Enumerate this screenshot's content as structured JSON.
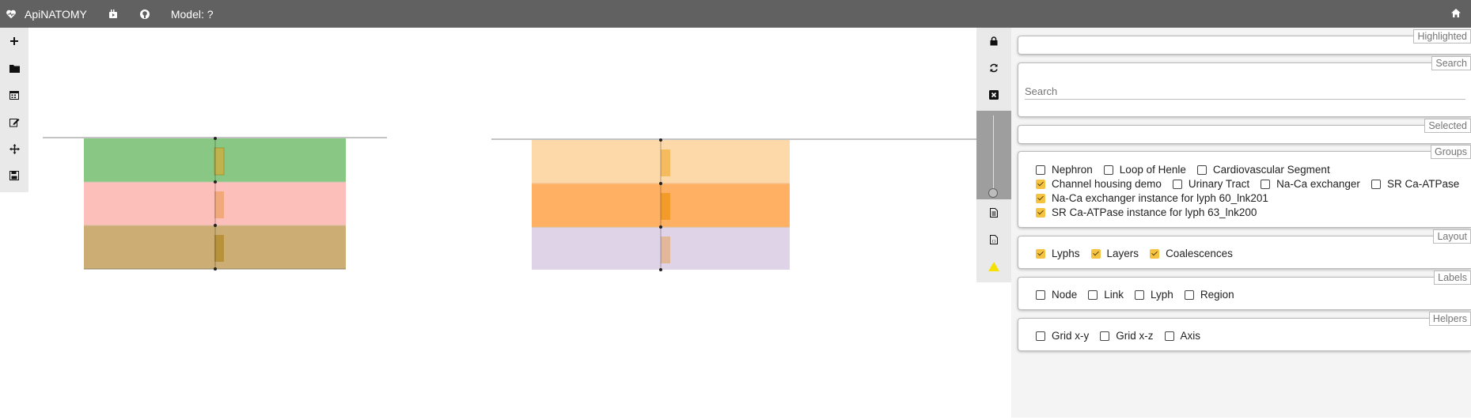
{
  "topbar": {
    "app_name": "ApiNATOMY",
    "model_label": "Model: ?",
    "icons": [
      "heart-icon",
      "youtube-icon",
      "github-icon",
      "home-icon"
    ]
  },
  "left_toolbar": [
    "plus-icon",
    "folder-icon",
    "calendar-icon",
    "edit-icon",
    "move-icon",
    "save-icon"
  ],
  "right_toolbar": {
    "icons": [
      "lock-icon",
      "refresh-icon",
      "close-icon",
      "file-icon",
      "json-file-icon",
      "warning-icon"
    ],
    "zoom_level": 0
  },
  "panel": {
    "highlighted": {
      "legend": "Highlighted",
      "value": ""
    },
    "search": {
      "legend": "Search",
      "placeholder": "Search"
    },
    "selected": {
      "legend": "Selected",
      "value": ""
    },
    "groups": {
      "legend": "Groups",
      "rows": [
        [
          {
            "label": "Nephron",
            "checked": false
          },
          {
            "label": "Loop of Henle",
            "checked": false
          },
          {
            "label": "Cardiovascular Segment",
            "checked": false
          }
        ],
        [
          {
            "label": "Channel housing demo",
            "checked": true
          },
          {
            "label": "Urinary Tract",
            "checked": false
          },
          {
            "label": "Na-Ca exchanger",
            "checked": false
          },
          {
            "label": "SR Ca-ATPase",
            "checked": false
          }
        ],
        [
          {
            "label": "Na-Ca exchanger instance for lyph 60_lnk201",
            "checked": true
          }
        ],
        [
          {
            "label": "SR Ca-ATPase instance for lyph 63_lnk200",
            "checked": true
          }
        ]
      ]
    },
    "layout": {
      "legend": "Layout",
      "items": [
        {
          "label": "Lyphs",
          "checked": true
        },
        {
          "label": "Layers",
          "checked": true
        },
        {
          "label": "Coalescences",
          "checked": true
        }
      ]
    },
    "labels": {
      "legend": "Labels",
      "items": [
        {
          "label": "Node",
          "checked": false
        },
        {
          "label": "Link",
          "checked": false
        },
        {
          "label": "Lyph",
          "checked": false
        },
        {
          "label": "Region",
          "checked": false
        }
      ]
    },
    "helpers": {
      "legend": "Helpers",
      "items": [
        {
          "label": "Grid x-y",
          "checked": false
        },
        {
          "label": "Grid x-z",
          "checked": false
        },
        {
          "label": "Axis",
          "checked": false
        }
      ]
    }
  },
  "scene": {
    "left_lyph_colors": [
      "#88c884",
      "#fdbfba",
      "#ccad74"
    ],
    "right_lyph_colors": [
      "#fdd8a9",
      "#ffb062",
      "#dfd3e8"
    ]
  }
}
